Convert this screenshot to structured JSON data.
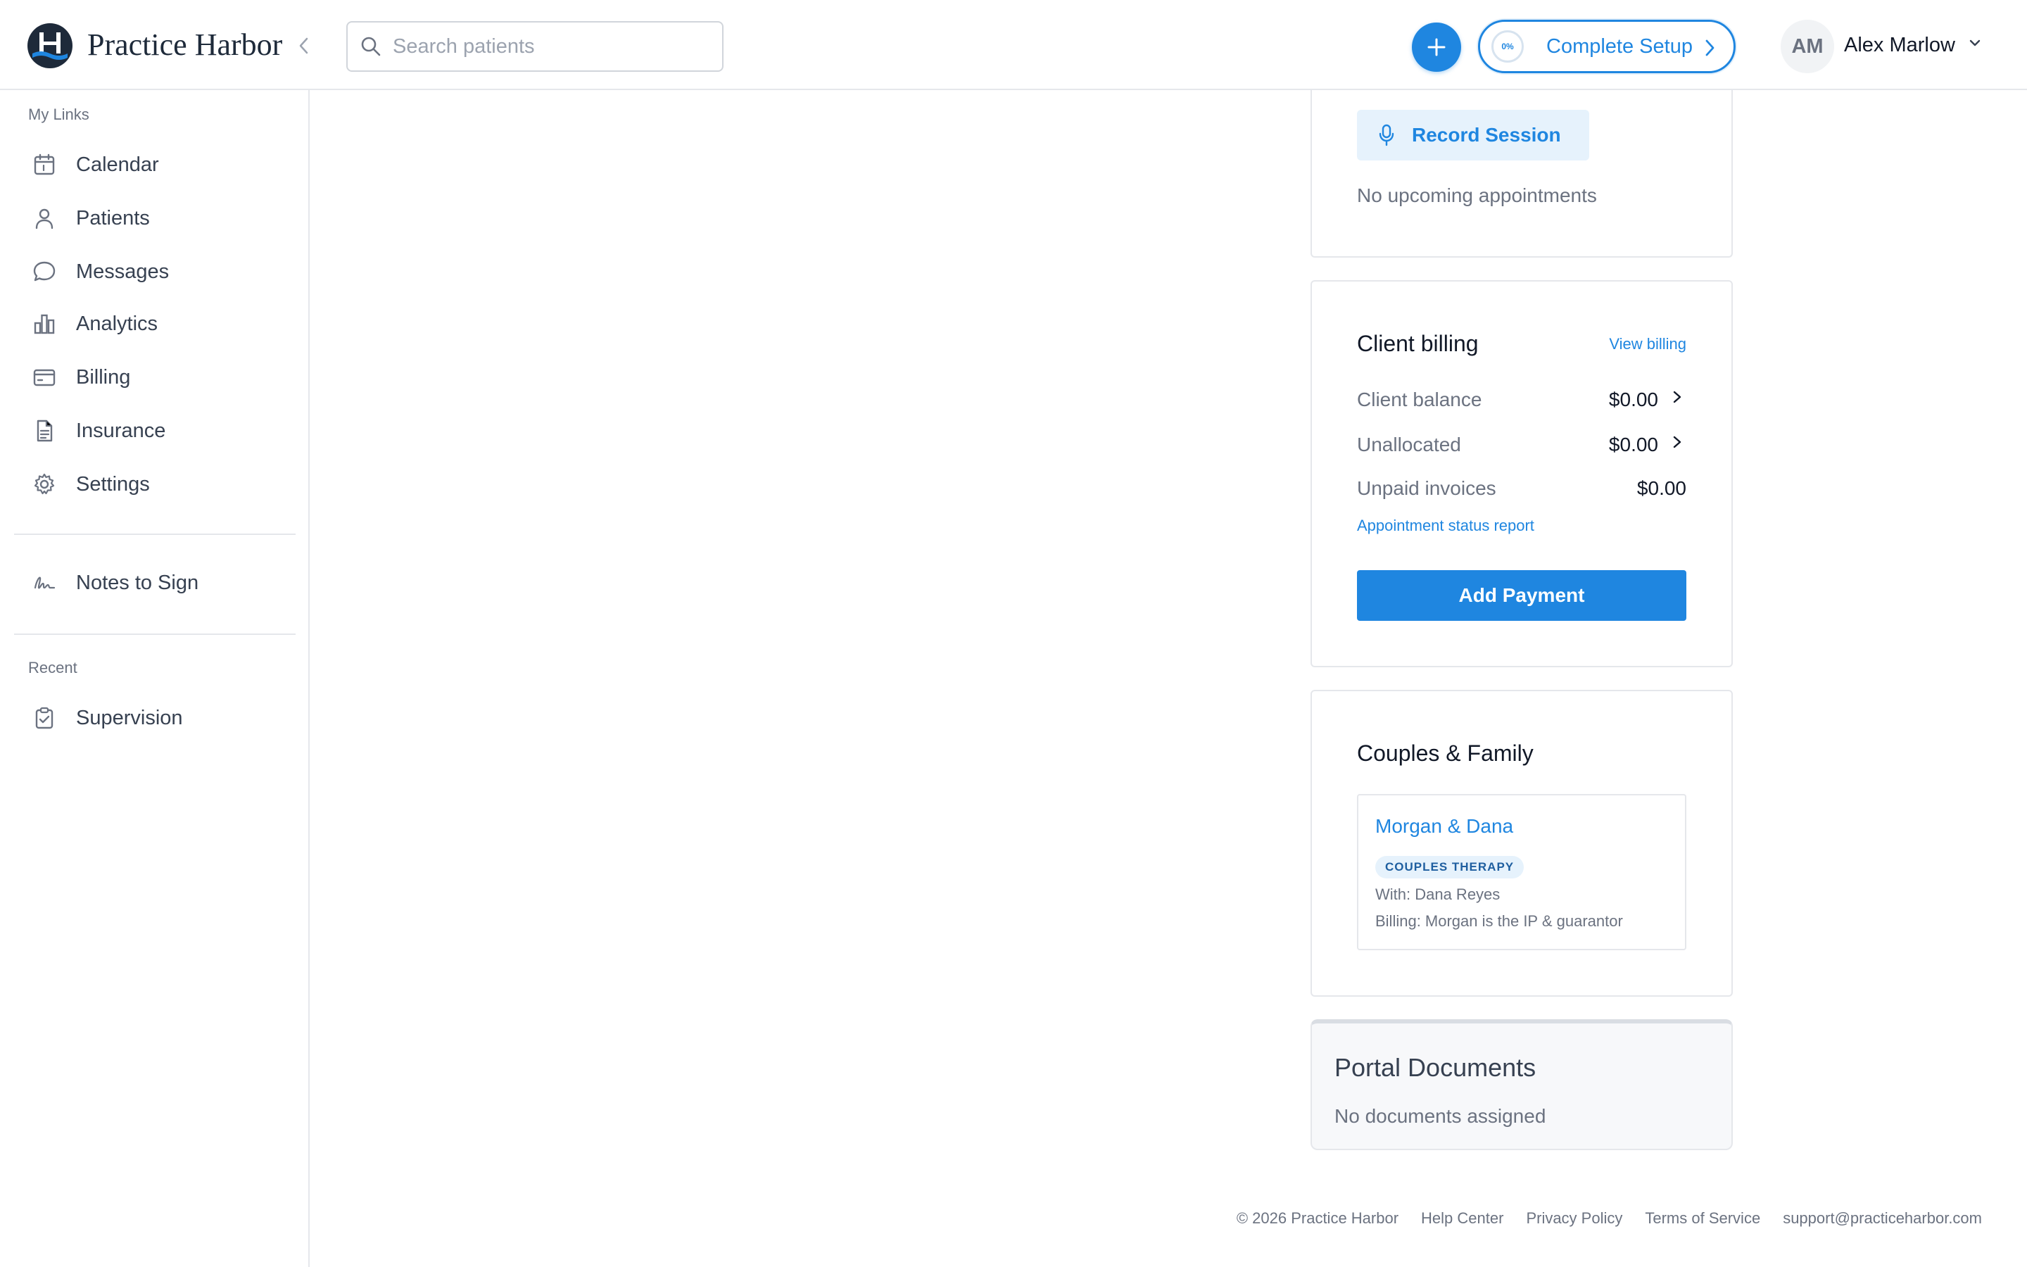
{
  "app": {
    "brand": "Practice Harbor"
  },
  "header": {
    "search_placeholder": "Search patients",
    "setup_label": "Complete Setup",
    "setup_progress": "0%",
    "user_initials": "AM",
    "user_name": "Alex Marlow"
  },
  "sidebar": {
    "my_links_label": "My Links",
    "items": [
      {
        "label": "Calendar",
        "icon": "calendar-icon"
      },
      {
        "label": "Patients",
        "icon": "person-icon"
      },
      {
        "label": "Messages",
        "icon": "chat-bubble-icon"
      },
      {
        "label": "Analytics",
        "icon": "bar-chart-icon"
      },
      {
        "label": "Billing",
        "icon": "credit-card-icon"
      },
      {
        "label": "Insurance",
        "icon": "document-icon"
      },
      {
        "label": "Settings",
        "icon": "gear-icon"
      }
    ],
    "notes_to_sign": {
      "label": "Notes to Sign",
      "icon": "signature-icon"
    },
    "recent_label": "Recent",
    "recent_items": [
      {
        "label": "Supervision",
        "icon": "clipboard-check-icon"
      }
    ]
  },
  "appointments": {
    "record_button": "Record Session",
    "empty_text": "No upcoming appointments"
  },
  "billing": {
    "title": "Client billing",
    "view_link": "View billing",
    "rows": [
      {
        "label": "Client balance",
        "value": "$0.00"
      },
      {
        "label": "Unallocated",
        "value": "$0.00"
      },
      {
        "label": "Unpaid invoices",
        "value": "$0.00"
      }
    ],
    "status_report_link": "Appointment status report",
    "add_payment_button": "Add Payment"
  },
  "family": {
    "title": "Couples & Family",
    "name": "Morgan & Dana",
    "badge": "COUPLES THERAPY",
    "with_text": "With: Dana Reyes",
    "billing_text": "Billing: Morgan is the IP & guarantor"
  },
  "portal": {
    "title": "Portal Documents",
    "empty_text": "No documents assigned"
  },
  "footer": {
    "copyright": "© 2026 Practice Harbor",
    "help": "Help Center",
    "privacy": "Privacy Policy",
    "terms": "Terms of Service",
    "email": "support@practiceharbor.com"
  },
  "colors": {
    "accent": "#1f86e0",
    "brand_navy": "#1e2a3a",
    "muted_text": "#6b7280",
    "border": "#e5e7eb"
  }
}
